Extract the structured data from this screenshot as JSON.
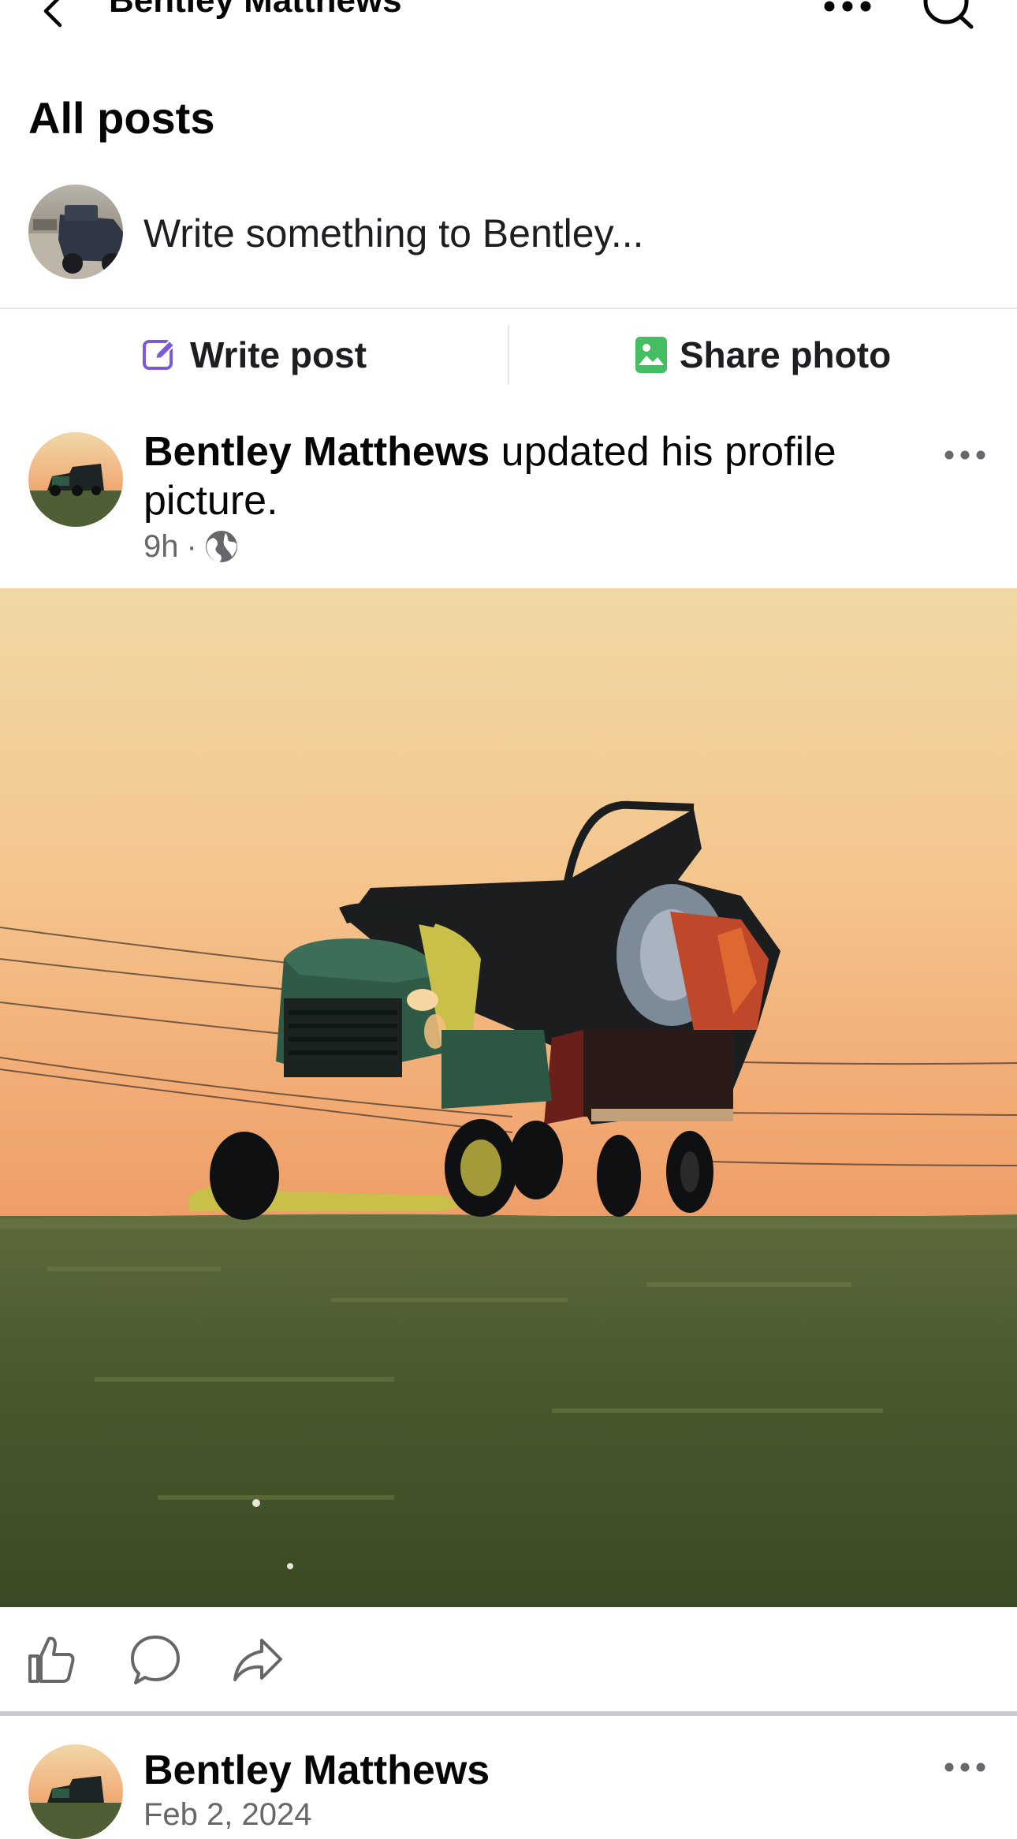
{
  "header": {
    "title": "Bentley Matthews",
    "back_icon": "chevron-left-icon",
    "more_icon": "more-horizontal-icon",
    "search_icon": "search-icon"
  },
  "section": {
    "title": "All posts"
  },
  "composer": {
    "placeholder": "Write something to Bentley..."
  },
  "actions": {
    "write_post": "Write post",
    "write_icon": "edit-icon",
    "share_photo": "Share photo",
    "share_icon": "photo-icon"
  },
  "post": {
    "author": "Bentley Matthews",
    "action_text": " updated his profile picture.",
    "time": "9h",
    "separator": "·",
    "privacy_icon": "globe-icon",
    "image_subject": "lawn tractor pulling trailer at sunset"
  },
  "reactions": {
    "like_icon": "like-icon",
    "comment_icon": "comment-icon",
    "share_icon": "share-icon"
  },
  "post2": {
    "author": "Bentley Matthews",
    "date": "Feb 2, 2024"
  },
  "colors": {
    "edit_icon": "#7b5bd6",
    "photo_icon": "#45bd62",
    "meta_text": "#65676b",
    "divider": "#e4e6eb"
  }
}
